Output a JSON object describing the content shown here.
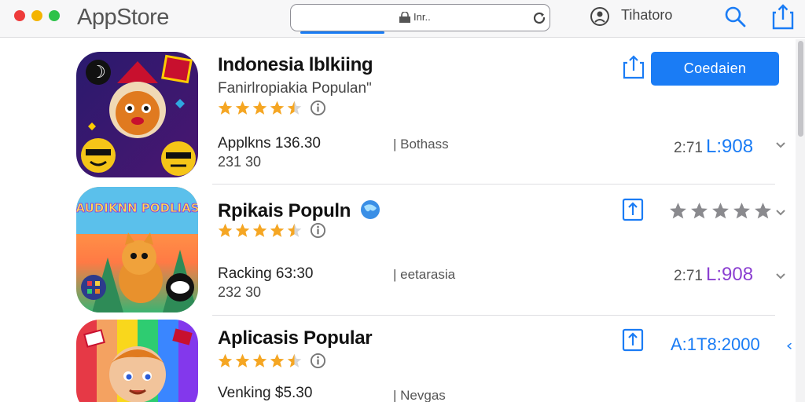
{
  "window": {
    "title": "AppStore",
    "search_text": "Inr..",
    "account_name": "Tihatoro"
  },
  "colors": {
    "accent": "#1a7cf5",
    "star": "#f5a623",
    "star_empty": "#c9c9c9",
    "price_purple": "#8b3fd1"
  },
  "icons": {
    "search": "search-icon",
    "share": "share-icon",
    "account": "account-icon",
    "reload": "reload-icon",
    "lock": "lock-icon",
    "info": "info-icon",
    "chevron": "chevron-down-icon"
  },
  "apps": [
    {
      "name": "Indonesia lblkiing",
      "subtitle": "Fanirlropiakia Populanʺ",
      "rating": 4.5,
      "meta_a": "Applkns 136.30",
      "meta_b": "231  30",
      "meta_c": "| Bothass",
      "button": "Coedaien",
      "price_small": "2:71",
      "price_big": "L:908"
    },
    {
      "name": "Rpikais Populn",
      "rating": 4.5,
      "meta_a": "Racking  63:30",
      "meta_b": "232  30",
      "meta_c": "| eetarasia",
      "price_small": "2:71",
      "price_big": "L:908",
      "aggregate_rating": 5
    },
    {
      "name": "Aplicasis Popular",
      "rating": 4.5,
      "meta_a": "Venking  $5.30",
      "meta_c": "| Nevgas",
      "price": "A:1T8:2000"
    }
  ],
  "icon_art": {
    "app1_badge": "☽",
    "app2_title": "AUDIKNN PODLIAS"
  }
}
